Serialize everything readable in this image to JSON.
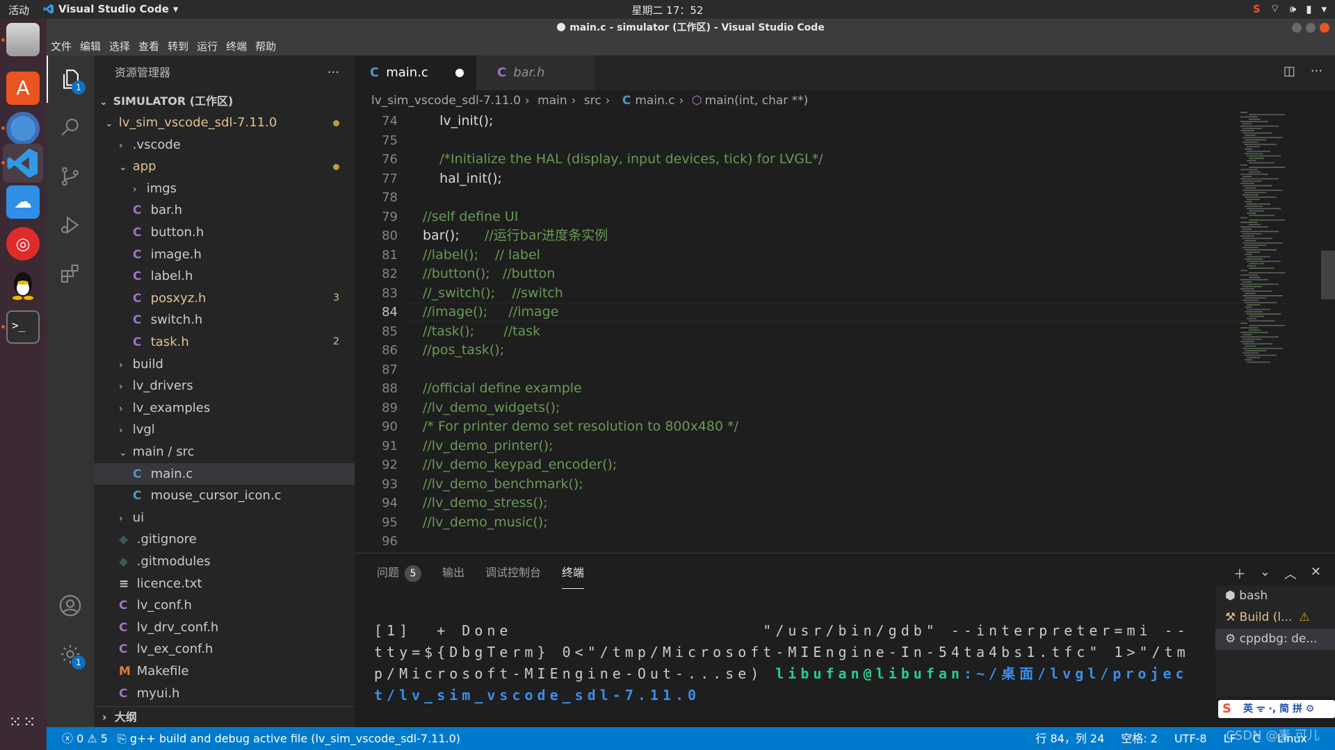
{
  "system": {
    "activities": "活动",
    "app_name": "Visual Studio Code",
    "clock": "星期二 17：52"
  },
  "window": {
    "title": "main.c - simulator (工作区) - Visual Studio Code"
  },
  "menu": [
    "文件",
    "编辑",
    "选择",
    "查看",
    "转到",
    "运行",
    "终端",
    "帮助"
  ],
  "activity_bar": {
    "explorer_badge": "1",
    "settings_badge": "1"
  },
  "sidebar": {
    "title": "资源管理器",
    "more": "···",
    "workspace": "SIMULATOR (工作区)",
    "items": [
      {
        "label": "lv_sim_vscode_sdl-7.11.0",
        "kind": "folder-open",
        "depth": 1,
        "color": "#e2c08d",
        "dot": true
      },
      {
        "label": ".vscode",
        "kind": "folder",
        "depth": 2,
        "color": "#cccccc"
      },
      {
        "label": "app",
        "kind": "folder-open",
        "depth": 2,
        "color": "#e2c08d",
        "dot": true
      },
      {
        "label": "imgs",
        "kind": "folder",
        "depth": 3,
        "color": "#cccccc"
      },
      {
        "label": "bar.h",
        "kind": "c",
        "depth": 3,
        "color": "#cccccc",
        "icon_color": "#a074c4"
      },
      {
        "label": "button.h",
        "kind": "c",
        "depth": 3,
        "color": "#cccccc",
        "icon_color": "#a074c4"
      },
      {
        "label": "image.h",
        "kind": "c",
        "depth": 3,
        "color": "#cccccc",
        "icon_color": "#a074c4"
      },
      {
        "label": "label.h",
        "kind": "c",
        "depth": 3,
        "color": "#cccccc",
        "icon_color": "#a074c4"
      },
      {
        "label": "posxyz.h",
        "kind": "c",
        "depth": 3,
        "color": "#e2c08d",
        "icon_color": "#a074c4",
        "badge": "3"
      },
      {
        "label": "switch.h",
        "kind": "c",
        "depth": 3,
        "color": "#cccccc",
        "icon_color": "#a074c4"
      },
      {
        "label": "task.h",
        "kind": "c",
        "depth": 3,
        "color": "#e2c08d",
        "icon_color": "#a074c4",
        "badge": "2"
      },
      {
        "label": "build",
        "kind": "folder",
        "depth": 2,
        "color": "#cccccc"
      },
      {
        "label": "lv_drivers",
        "kind": "folder",
        "depth": 2,
        "color": "#cccccc"
      },
      {
        "label": "lv_examples",
        "kind": "folder",
        "depth": 2,
        "color": "#cccccc"
      },
      {
        "label": "lvgl",
        "kind": "folder",
        "depth": 2,
        "color": "#cccccc"
      },
      {
        "label": "main / src",
        "kind": "folder-open",
        "depth": 2,
        "color": "#cccccc"
      },
      {
        "label": "main.c",
        "kind": "c",
        "depth": 3,
        "color": "#cccccc",
        "icon_color": "#519aba",
        "selected": true
      },
      {
        "label": "mouse_cursor_icon.c",
        "kind": "c",
        "depth": 3,
        "color": "#cccccc",
        "icon_color": "#519aba"
      },
      {
        "label": "ui",
        "kind": "folder",
        "depth": 2,
        "color": "#cccccc"
      },
      {
        "label": ".gitignore",
        "kind": "git",
        "depth": 2,
        "color": "#cccccc",
        "icon_color": "#41535b"
      },
      {
        "label": ".gitmodules",
        "kind": "git",
        "depth": 2,
        "color": "#cccccc",
        "icon_color": "#41535b"
      },
      {
        "label": "licence.txt",
        "kind": "txt",
        "depth": 2,
        "color": "#cccccc",
        "icon_color": "#cccccc"
      },
      {
        "label": "lv_conf.h",
        "kind": "c",
        "depth": 2,
        "color": "#cccccc",
        "icon_color": "#a074c4"
      },
      {
        "label": "lv_drv_conf.h",
        "kind": "c",
        "depth": 2,
        "color": "#cccccc",
        "icon_color": "#a074c4"
      },
      {
        "label": "lv_ex_conf.h",
        "kind": "c",
        "depth": 2,
        "color": "#cccccc",
        "icon_color": "#a074c4"
      },
      {
        "label": "Makefile",
        "kind": "make",
        "depth": 2,
        "color": "#cccccc",
        "icon_color": "#e37933"
      },
      {
        "label": "myui.h",
        "kind": "c",
        "depth": 2,
        "color": "#cccccc",
        "icon_color": "#a074c4"
      }
    ],
    "outline": "大纲"
  },
  "tabs": [
    {
      "label": "main.c",
      "active": true,
      "dirty": true
    },
    {
      "label": "bar.h",
      "active": false
    }
  ],
  "breadcrumb": [
    "lv_sim_vscode_sdl-7.11.0",
    "main",
    "src",
    "main.c",
    "main(int, char **)"
  ],
  "code": {
    "active_line": 84,
    "lines": [
      {
        "n": 74,
        "text": "    lv_init();",
        "type": "fn"
      },
      {
        "n": 75,
        "text": "",
        "type": "fn"
      },
      {
        "n": 76,
        "text": "    /*Initialize the HAL (display, input devices, tick) for LVGL*/",
        "type": "cm"
      },
      {
        "n": 77,
        "text": "    hal_init();",
        "type": "fn"
      },
      {
        "n": 78,
        "text": "",
        "type": "fn"
      },
      {
        "n": 79,
        "text": "//self define UI",
        "type": "cm"
      },
      {
        "n": 80,
        "text": "bar();      //运行bar进度条实例",
        "type": "mixed",
        "code": "bar();      ",
        "comment": "//运行bar进度条实例"
      },
      {
        "n": 81,
        "text": "//label();    // label",
        "type": "cm"
      },
      {
        "n": 82,
        "text": "//button();   //button",
        "type": "cm"
      },
      {
        "n": 83,
        "text": "//_switch();    //switch",
        "type": "cm"
      },
      {
        "n": 84,
        "text": "//image();     //image",
        "type": "cm"
      },
      {
        "n": 85,
        "text": "//task();       //task",
        "type": "cm"
      },
      {
        "n": 86,
        "text": "//pos_task();",
        "type": "cm"
      },
      {
        "n": 87,
        "text": "",
        "type": "fn"
      },
      {
        "n": 88,
        "text": "//official define example",
        "type": "cm"
      },
      {
        "n": 89,
        "text": "//lv_demo_widgets();",
        "type": "cm"
      },
      {
        "n": 90,
        "text": "/* For printer demo set resolution to 800x480 */",
        "type": "cm"
      },
      {
        "n": 91,
        "text": "//lv_demo_printer();",
        "type": "cm"
      },
      {
        "n": 92,
        "text": "//lv_demo_keypad_encoder();",
        "type": "cm"
      },
      {
        "n": 93,
        "text": "//lv_demo_benchmark();",
        "type": "cm"
      },
      {
        "n": 94,
        "text": "//lv_demo_stress();",
        "type": "cm"
      },
      {
        "n": 95,
        "text": "//lv_demo_music();",
        "type": "cm"
      },
      {
        "n": 96,
        "text": "",
        "type": "fn"
      }
    ]
  },
  "panel": {
    "tabs": [
      "问题",
      "输出",
      "调试控制台",
      "终端"
    ],
    "problems_count": "5",
    "active_tab": "终端",
    "terminal_line1": "[1]  + Done                       \"/usr/bin/gdb\" --interpreter=mi --tty=${DbgTerm} 0<\"/tmp/Microsoft-MIEngine-In-54ta4bs1.tfc\" 1>\"/tmp/Microsoft-MIEngine-Out-...\"",
    "terminal_text": "[1]  + Done                    \"/usr/bin/gdb\" --interpreter=mi --tty=${DbgTerm} 0<\"/tmp/Microsoft-MIEngine-In-54ta4bs1.tfc\" 1>\"/tmp/Microsoft-MIEngine-Out-...",
    "terminal_tail": "se) ",
    "prompt_user": "libufan@libufan",
    "prompt_path": ":~/桌面/lvgl/project/lv_sim_vscode_sdl-7.11.0",
    "terminals": [
      "bash",
      "Build (l...",
      "cppdbg: de..."
    ]
  },
  "ime": "英 ᯤ ·, 简 拼 ⚙",
  "status": {
    "errors": "0",
    "warnings": "5",
    "task": "g++ build and debug active file (lv_sim_vscode_sdl-7.11.0)",
    "position": "行 84，列 24",
    "spaces": "空格: 2",
    "encoding": "UTF-8",
    "eol": "LF",
    "language": "C",
    "os": "Linux",
    "watermark": "CSDN @麦.可儿"
  }
}
